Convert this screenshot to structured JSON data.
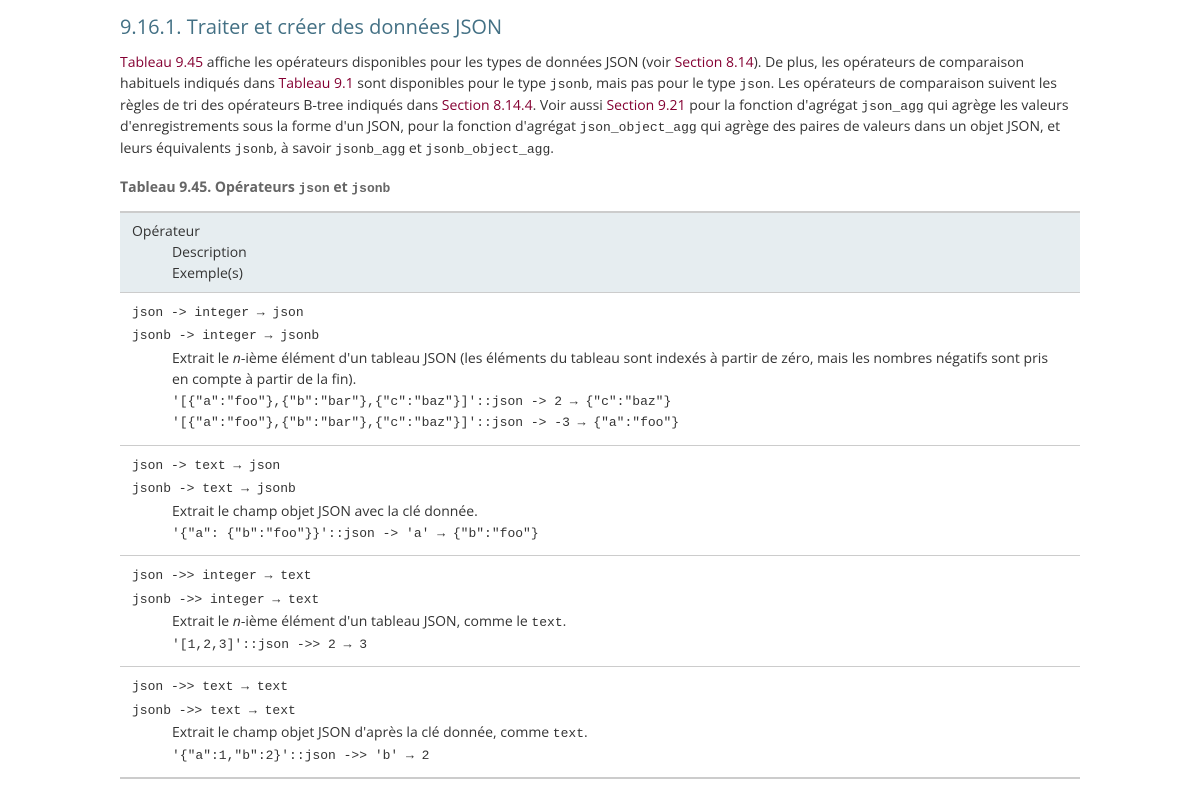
{
  "heading": "9.16.1. Traiter et créer des données JSON",
  "intro": {
    "t1_link": "Tableau 9.45",
    "t1_after": " affiche les opérateurs disponibles pour les types de données JSON (voir ",
    "t1_link2": "Section 8.14",
    "t1_after2": "). De plus, les opérateurs de comparaison habituels indiqués dans ",
    "t2_link": "Tableau 9.1",
    "t2_after": " sont disponibles pour le type ",
    "t2_code1": "jsonb",
    "t2_mid": ", mais pas pour le type ",
    "t2_code2": "json",
    "t2_after2": ". Les opérateurs de comparaison suivent les règles de tri des opérateurs B-tree indiqués dans ",
    "t3_link": "Section 8.14.4",
    "t3_after": ". Voir aussi ",
    "t3_link2": "Section 9.21",
    "t3_after2": " pour la fonction d'agrégat ",
    "t3_code1": "json_agg",
    "t3_mid": " qui agrège les valeurs d'enregistrements sous la forme d'un JSON, pour la fonction d'agrégat ",
    "t3_code2": "json_object_agg",
    "t3_mid2": " qui agrège des paires de valeurs dans un objet JSON, et leurs équivalents ",
    "t3_code3": "jsonb",
    "t3_mid3": ", à savoir ",
    "t3_code4": "jsonb_agg",
    "t3_mid4": " et ",
    "t3_code5": "jsonb_object_agg",
    "t3_end": "."
  },
  "table_caption": {
    "prefix": "Tableau 9.45. Opérateurs ",
    "code1": "json",
    "mid": " et ",
    "code2": "jsonb"
  },
  "headers": {
    "operator": "Opérateur",
    "description": "Description",
    "examples": "Exemple(s)"
  },
  "rows": [
    {
      "sig1": "json -> integer → json",
      "sig2": "jsonb -> integer → jsonb",
      "desc_pre": "Extrait le ",
      "desc_em": "n",
      "desc_post": "-ième élément d'un tableau JSON (les éléments du tableau sont indexés à partir de zéro, mais les nombres négatifs sont pris en compte à partir de la fin).",
      "examples": [
        "'[{\"a\":\"foo\"},{\"b\":\"bar\"},{\"c\":\"baz\"}]'::json -> 2 → {\"c\":\"baz\"}",
        "'[{\"a\":\"foo\"},{\"b\":\"bar\"},{\"c\":\"baz\"}]'::json -> -3 → {\"a\":\"foo\"}"
      ]
    },
    {
      "sig1": "json -> text → json",
      "sig2": "jsonb -> text → jsonb",
      "desc_full": "Extrait le champ objet JSON avec la clé donnée.",
      "examples": [
        "'{\"a\": {\"b\":\"foo\"}}'::json -> 'a' → {\"b\":\"foo\"}"
      ]
    },
    {
      "sig1": "json ->> integer → text",
      "sig2": "jsonb ->> integer → text",
      "desc_pre": "Extrait le ",
      "desc_em": "n",
      "desc_post": "-ième élément d'un tableau JSON, comme le ",
      "desc_code": "text",
      "desc_end": ".",
      "examples": [
        "'[1,2,3]'::json ->> 2 → 3"
      ]
    },
    {
      "sig1": "json ->> text → text",
      "sig2": "jsonb ->> text → text",
      "desc_pre2": "Extrait le champ objet JSON d'après la clé donnée, comme ",
      "desc_code": "text",
      "desc_end": ".",
      "examples": [
        "'{\"a\":1,\"b\":2}'::json ->> 'b' → 2"
      ]
    }
  ]
}
